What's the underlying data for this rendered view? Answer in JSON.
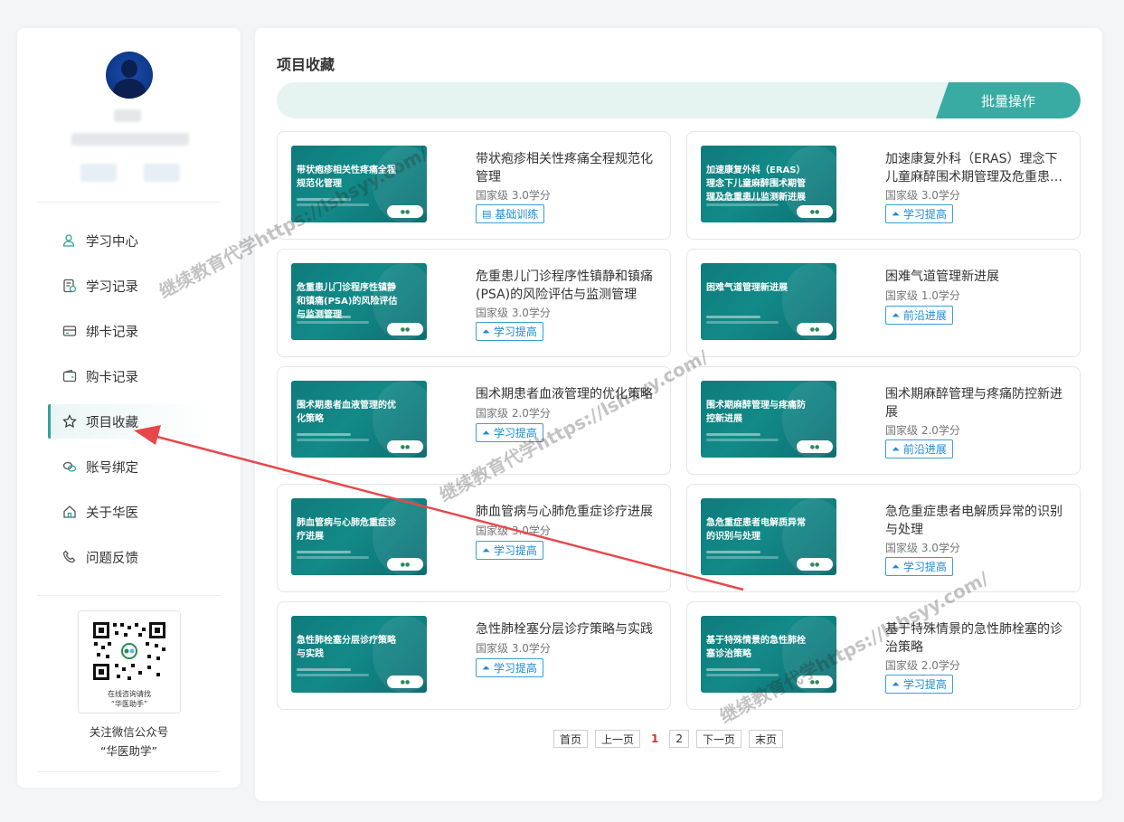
{
  "sidebar": {
    "nav": [
      {
        "label": "学习中心",
        "icon": "user-icon"
      },
      {
        "label": "学习记录",
        "icon": "record-icon"
      },
      {
        "label": "绑卡记录",
        "icon": "card-icon"
      },
      {
        "label": "购卡记录",
        "icon": "wallet-icon"
      },
      {
        "label": "项目收藏",
        "icon": "star-icon",
        "active": true
      },
      {
        "label": "账号绑定",
        "icon": "link-icon"
      },
      {
        "label": "关于华医",
        "icon": "home-icon"
      },
      {
        "label": "问题反馈",
        "icon": "phone-icon"
      }
    ],
    "qr_caption_1": "在线咨询请找",
    "qr_caption_2": "“华医助手”",
    "follow_1": "关注微信公众号",
    "follow_2": "“华医助学”"
  },
  "main": {
    "title": "项目收藏",
    "batch_label": "批量操作",
    "cards": [
      {
        "title": "带状疱疹相关性疼痛全程规范化管理",
        "thumb": "带状疱疹相关性疼痛全程规范化管理",
        "credit": "国家级 3.0学分",
        "tag": "基础训练"
      },
      {
        "title": "加速康复外科（ERAS）理念下儿童麻醉围术期管理及危重患…",
        "thumb": "加速康复外科（ERAS）理念下儿童麻醉围术期管理及危重患儿监测新进展",
        "credit": "国家级 3.0学分",
        "tag": "学习提高"
      },
      {
        "title": "危重患儿门诊程序性镇静和镇痛(PSA)的风险评估与监测管理",
        "thumb": "危重患儿门诊程序性镇静和镇痛(PSA)的风险评估与监测管理",
        "credit": "国家级 3.0学分",
        "tag": "学习提高"
      },
      {
        "title": "困难气道管理新进展",
        "thumb": "困难气道管理新进展",
        "credit": "国家级 1.0学分",
        "tag": "前沿进展"
      },
      {
        "title": "围术期患者血液管理的优化策略",
        "thumb": "围术期患者血液管理的优化策略",
        "credit": "国家级 2.0学分",
        "tag": "学习提高"
      },
      {
        "title": "围术期麻醉管理与疼痛防控新进展",
        "thumb": "围术期麻醉管理与疼痛防控新进展",
        "credit": "国家级 2.0学分",
        "tag": "前沿进展"
      },
      {
        "title": "肺血管病与心肺危重症诊疗进展",
        "thumb": "肺血管病与心肺危重症诊疗进展",
        "credit": "国家级 3.0学分",
        "tag": "学习提高"
      },
      {
        "title": "急危重症患者电解质异常的识别与处理",
        "thumb": "急危重症患者电解质异常的识别与处理",
        "credit": "国家级 3.0学分",
        "tag": "学习提高"
      },
      {
        "title": "急性肺栓塞分层诊疗策略与实践",
        "thumb": "急性肺栓塞分层诊疗策略与实践",
        "credit": "国家级 3.0学分",
        "tag": "学习提高"
      },
      {
        "title": "基于特殊情景的急性肺栓塞的诊治策略",
        "thumb": "基于特殊情景的急性肺栓塞诊治策略",
        "credit": "国家级 2.0学分",
        "tag": "学习提高"
      }
    ],
    "pager": {
      "first": "首页",
      "prev": "上一页",
      "current": "1",
      "page2": "2",
      "next": "下一页",
      "last": "末页"
    }
  },
  "watermark": "继续教育代学https://lshsyy.com/",
  "colors": {
    "accent": "#39aba3",
    "tag": "#1e8ad3",
    "arrow": "#e8474a"
  }
}
